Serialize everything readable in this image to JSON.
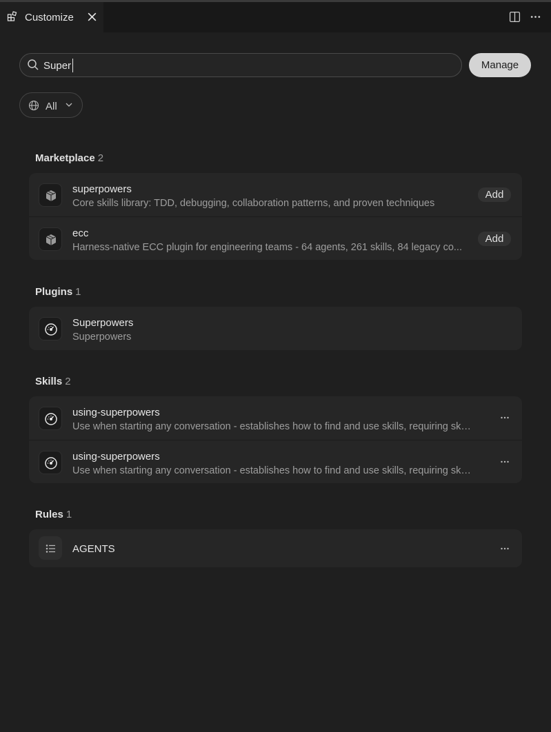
{
  "tab": {
    "label": "Customize"
  },
  "search": {
    "value": "Super"
  },
  "manage_label": "Manage",
  "filter": {
    "label": "All"
  },
  "sections": {
    "marketplace": {
      "title": "Marketplace",
      "count": "2",
      "items": [
        {
          "title": "superpowers",
          "desc": "Core skills library: TDD, debugging, collaboration patterns, and proven techniques",
          "action": "Add",
          "icon": "package-icon"
        },
        {
          "title": "ecc",
          "desc": "Harness-native ECC plugin for engineering teams - 64 agents, 261 skills, 84 legacy co...",
          "action": "Add",
          "icon": "package-icon"
        }
      ]
    },
    "plugins": {
      "title": "Plugins",
      "count": "1",
      "items": [
        {
          "title": "Superpowers",
          "desc": "Superpowers",
          "icon": "gauge-icon"
        }
      ]
    },
    "skills": {
      "title": "Skills",
      "count": "2",
      "items": [
        {
          "title": "using-superpowers",
          "desc": "Use when starting any conversation - establishes how to find and use skills, requiring skill...",
          "icon": "gauge-icon"
        },
        {
          "title": "using-superpowers",
          "desc": "Use when starting any conversation - establishes how to find and use skills, requiring skill...",
          "icon": "gauge-icon"
        }
      ]
    },
    "rules": {
      "title": "Rules",
      "count": "1",
      "items": [
        {
          "title": "AGENTS",
          "icon": "list-icon"
        }
      ]
    }
  },
  "colors": {
    "background": "#1f1f1f",
    "card": "#262626",
    "manage_button": "#d4d4d4",
    "text": "#e6e6e6",
    "muted": "#9d9d9d"
  }
}
